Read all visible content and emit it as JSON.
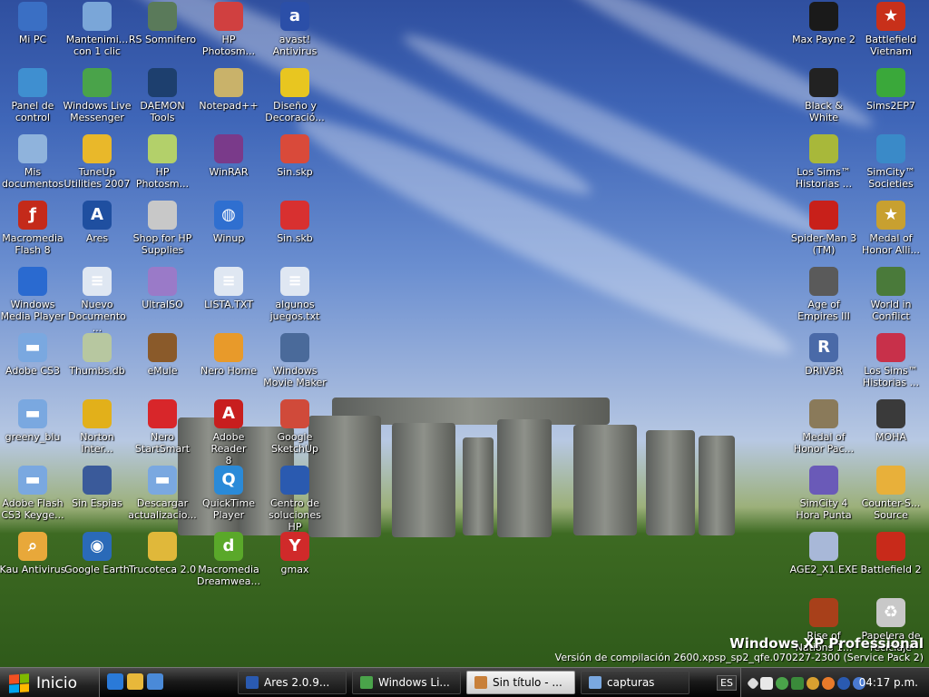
{
  "colors": {
    "taskbar": "#111111",
    "active_task": "#e6e6e6",
    "label_text": "#ffffff"
  },
  "desktop": {
    "icons": [
      {
        "label": "Mi PC",
        "icon": "my-computer-icon",
        "color": "#3a6fc4"
      },
      {
        "label": "Mantenimi...\ncon 1 clic",
        "icon": "maintenance-icon",
        "color": "#7aa6d8"
      },
      {
        "label": "RS Somnifero",
        "icon": "syringe-icon",
        "color": "#5a7a5a"
      },
      {
        "label": "HP\nPhotosm...",
        "icon": "hp-photosmart-icon",
        "color": "#d04040"
      },
      {
        "label": "avast!\nAntivirus",
        "icon": "avast-icon",
        "color": "#2b4fa8"
      },
      {
        "label": "Panel de\ncontrol",
        "icon": "control-panel-icon",
        "color": "#3f8fd0"
      },
      {
        "label": "Windows Live\nMessenger",
        "icon": "messenger-icon",
        "color": "#4aa34a"
      },
      {
        "label": "DAEMON\nTools",
        "icon": "daemon-tools-icon",
        "color": "#1d3f6e"
      },
      {
        "label": "Notepad++",
        "icon": "notepad-icon",
        "color": "#c9b26a"
      },
      {
        "label": "Diseño y\nDecoració...",
        "icon": "construction-helmet-icon",
        "color": "#e8c620"
      },
      {
        "label": "Mis\ndocumentos",
        "icon": "my-documents-icon",
        "color": "#8fb3dc"
      },
      {
        "label": "TuneUp\nUtilities 2007",
        "icon": "tuneup-icon",
        "color": "#e9b82a"
      },
      {
        "label": "HP\nPhotosm...",
        "icon": "hp-photosmart-icon",
        "color": "#b3d06a"
      },
      {
        "label": "WinRAR",
        "icon": "winrar-icon",
        "color": "#7a3a8a"
      },
      {
        "label": "Sin.skp",
        "icon": "sketchup-file-icon",
        "color": "#d94a3a"
      },
      {
        "label": "Macromedia\nFlash 8",
        "icon": "flash-icon",
        "color": "#c42a1a"
      },
      {
        "label": "Ares",
        "icon": "ares-icon",
        "color": "#1f4fa0"
      },
      {
        "label": "Shop for HP\nSupplies",
        "icon": "hp-shop-icon",
        "color": "#c8c8c8"
      },
      {
        "label": "Winup",
        "icon": "globe-icon",
        "color": "#2f6fd0"
      },
      {
        "label": "Sin.skb",
        "icon": "sketchup-backup-icon",
        "color": "#d83030"
      },
      {
        "label": "Windows\nMedia Player",
        "icon": "media-player-icon",
        "color": "#2a6ad0"
      },
      {
        "label": "Nuevo\nDocumento ...",
        "icon": "text-document-icon",
        "color": "#dfe7f2"
      },
      {
        "label": "UltraISO",
        "icon": "ultraiso-icon",
        "color": "#9a7ac8"
      },
      {
        "label": "LISTA.TXT",
        "icon": "text-document-icon",
        "color": "#dfe7f2"
      },
      {
        "label": "algunos\njuegos.txt",
        "icon": "text-document-icon",
        "color": "#dfe7f2"
      },
      {
        "label": "Adobe CS3",
        "icon": "folder-icon",
        "color": "#7aa8e0"
      },
      {
        "label": "Thumbs.db",
        "icon": "database-file-icon",
        "color": "#b7c7a0"
      },
      {
        "label": "eMule",
        "icon": "emule-icon",
        "color": "#8a5a2a"
      },
      {
        "label": "Nero Home",
        "icon": "nero-home-icon",
        "color": "#e89a2a"
      },
      {
        "label": "Windows\nMovie Maker",
        "icon": "movie-maker-icon",
        "color": "#4a6a9a"
      },
      {
        "label": "greeny_blu",
        "icon": "folder-icon",
        "color": "#7aa8e0"
      },
      {
        "label": "Norton\nInter...",
        "icon": "norton-icon",
        "color": "#e2b01a"
      },
      {
        "label": "Nero\nStartSmart",
        "icon": "nero-icon",
        "color": "#d8262a"
      },
      {
        "label": "Adobe Reader\n8",
        "icon": "adobe-reader-icon",
        "color": "#c81e1e"
      },
      {
        "label": "Google\nSketchUp",
        "icon": "sketchup-icon",
        "color": "#d04a3a"
      },
      {
        "label": "Adobe Flash\nCS3 Keyge...",
        "icon": "folder-icon",
        "color": "#7aa8e0"
      },
      {
        "label": "Sin Espias",
        "icon": "spy-icon",
        "color": "#3a5a9a"
      },
      {
        "label": "Descargar\nactualizacio...",
        "icon": "folder-icon",
        "color": "#7aa8e0"
      },
      {
        "label": "QuickTime\nPlayer",
        "icon": "quicktime-icon",
        "color": "#2a8ad8"
      },
      {
        "label": "Centro de\nsoluciones HP",
        "icon": "hp-solution-center-icon",
        "color": "#2a5ab0"
      },
      {
        "label": "Kau Antivirus",
        "icon": "magnifier-icon",
        "color": "#e8a83a"
      },
      {
        "label": "Google Earth",
        "icon": "google-earth-icon",
        "color": "#2a6ab8"
      },
      {
        "label": "Trucoteca 2.0",
        "icon": "trucoteca-icon",
        "color": "#e0b83a"
      },
      {
        "label": "Macromedia\nDreamwea...",
        "icon": "dreamweaver-icon",
        "color": "#5aa82a"
      },
      {
        "label": "gmax",
        "icon": "gmax-icon",
        "color": "#d02a2a"
      },
      {
        "label": "Max Payne 2",
        "icon": "max-payne-icon",
        "color": "#1a1a1a"
      },
      {
        "label": "Battlefield\nVietnam",
        "icon": "battlefield-star-icon",
        "color": "#c8301a"
      },
      {
        "label": "Black & White",
        "icon": "black-white-icon",
        "color": "#222222"
      },
      {
        "label": "Sims2EP7",
        "icon": "sims-icon",
        "color": "#3aa83a"
      },
      {
        "label": "Los Sims™\nHistorias ...",
        "icon": "sims-stories-icon",
        "color": "#a8b83a"
      },
      {
        "label": "SimCity™\nSocieties",
        "icon": "simcity-icon",
        "color": "#3a8ac8"
      },
      {
        "label": "Spider-Man 3\n(TM)",
        "icon": "spiderman-icon",
        "color": "#c8201a"
      },
      {
        "label": "Medal of\nHonor Alli...",
        "icon": "medal-icon",
        "color": "#c8a030"
      },
      {
        "label": "Age of\nEmpires III",
        "icon": "age-of-empires-icon",
        "color": "#5a5a5a"
      },
      {
        "label": "World in\nConflict",
        "icon": "world-in-conflict-icon",
        "color": "#4a7a3a"
      },
      {
        "label": "DRIV3R",
        "icon": "driv3r-icon",
        "color": "#4a6aa8"
      },
      {
        "label": "Los Sims™\nHistorias ...",
        "icon": "sims-stories-icon",
        "color": "#c8304a"
      },
      {
        "label": "Medal of\nHonor Pac...",
        "icon": "medal-of-honor-icon",
        "color": "#8a7a5a"
      },
      {
        "label": "MOHA",
        "icon": "moha-icon",
        "color": "#3a3a3a"
      },
      {
        "label": "SimCity 4\nHora Punta",
        "icon": "simcity4-icon",
        "color": "#6a5ab8"
      },
      {
        "label": "Counter-S...\nSource",
        "icon": "counter-strike-icon",
        "color": "#e8b03a"
      },
      {
        "label": "AGE2_X1.EXE",
        "icon": "age2-icon",
        "color": "#a8b8d8"
      },
      {
        "label": "Battlefield 2",
        "icon": "battlefield2-icon",
        "color": "#c82a1a"
      },
      {
        "label": "Rise of\nNations 1...",
        "icon": "rise-of-nations-icon",
        "color": "#a8401a"
      },
      {
        "label": "Papelera de\nreciclaje",
        "icon": "recycle-bin-icon",
        "color": "#c8c8c8"
      }
    ],
    "watermark": {
      "title": "Windows XP Professional",
      "build": "Versión de compilación 2600.xpsp_sp2_qfe.070227-2300 (Service Pack 2)"
    }
  },
  "taskbar": {
    "start_label": "Inicio",
    "quick_launch": [
      "internet-explorer-icon",
      "outlook-express-icon",
      "show-desktop-icon"
    ],
    "tasks": [
      {
        "label": "Ares 2.0.9...",
        "icon": "ares-icon",
        "color": "#2a5ab0",
        "active": false
      },
      {
        "label": "Windows Li...",
        "icon": "messenger-icon",
        "color": "#4aa34a",
        "active": false
      },
      {
        "label": "Sin título - ...",
        "icon": "paint-icon",
        "color": "#c8803a",
        "active": true
      },
      {
        "label": "capturas",
        "icon": "folder-icon",
        "color": "#7aa8e0",
        "active": false
      }
    ],
    "language": "ES",
    "tray_icons": [
      "network-icon",
      "safely-remove-icon",
      "messenger-tray-icon",
      "security-icon",
      "emule-tray-icon",
      "norton-tray-icon",
      "avast-tray-icon",
      "info-icon"
    ],
    "clock": "04:17 p.m."
  }
}
